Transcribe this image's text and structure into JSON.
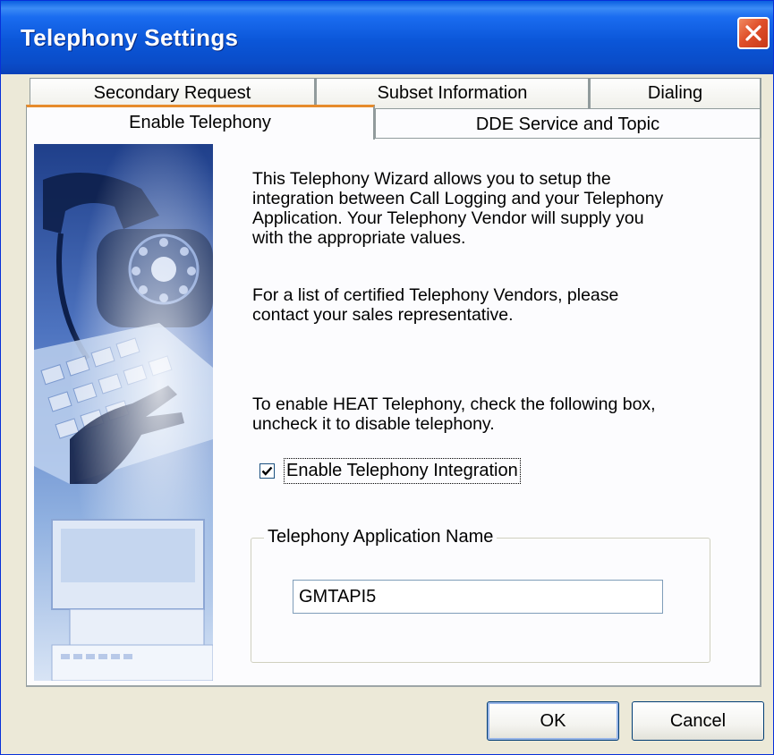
{
  "window": {
    "title": "Telephony Settings",
    "close_icon": "close-icon"
  },
  "tabs": {
    "back_row": [
      "Secondary Request",
      "Subset Information",
      "Dialing"
    ],
    "front_row": [
      "Enable Telephony",
      "DDE Service and Topic"
    ],
    "active": "Enable Telephony"
  },
  "content": {
    "intro_lines": [
      "This Telephony Wizard allows you to setup the",
      "integration between Call Logging and your Telephony",
      "Application.  Your Telephony Vendor will supply you",
      "with the appropriate values."
    ],
    "vendors_lines": [
      "For a list of certified Telephony Vendors, please",
      "contact your sales representative."
    ],
    "enable_lines": [
      "To enable HEAT Telephony, check the following box,",
      "uncheck it to disable telephony."
    ],
    "checkbox": {
      "label": "Enable Telephony Integration",
      "checked": true
    },
    "group": {
      "legend": "Telephony Application Name",
      "value": "GMTAPI5"
    }
  },
  "buttons": {
    "ok": "OK",
    "cancel": "Cancel"
  },
  "colors": {
    "title_bar": "#0a5fe0",
    "dialog_bg": "#ece9d8",
    "panel_bg": "#fcfcfe",
    "active_tab_accent": "#e68b2c"
  }
}
